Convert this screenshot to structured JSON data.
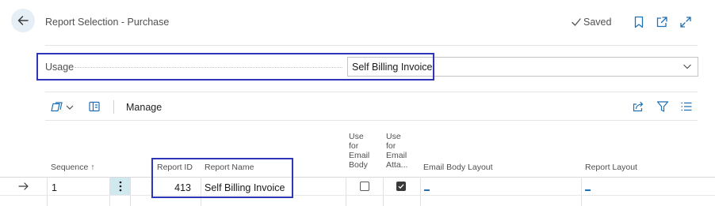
{
  "header": {
    "title": "Report Selection - Purchase",
    "saved_label": "Saved"
  },
  "usage": {
    "label": "Usage",
    "value": "Self Billing Invoice"
  },
  "toolbar": {
    "manage_label": "Manage"
  },
  "table": {
    "headers": {
      "sequence": "Sequence ↑",
      "report_id": "Report ID",
      "report_name": "Report Name",
      "use_email_body": [
        "Use",
        "for",
        "Email",
        "Body"
      ],
      "use_email_attachment": [
        "Use",
        "for",
        "Email",
        "Atta..."
      ],
      "email_body_layout": "Email Body Layout",
      "report_layout": "Report Layout"
    },
    "rows": [
      {
        "sequence": "1",
        "report_id": "413",
        "report_name": "Self Billing Invoice",
        "use_for_email_body": false,
        "use_for_email_attachment": true,
        "email_body_layout": "",
        "report_layout": ""
      }
    ]
  },
  "colors": {
    "highlight": "#2f35b7",
    "accent": "#1f6fb2",
    "selected_cell": "#cfe9ee"
  }
}
